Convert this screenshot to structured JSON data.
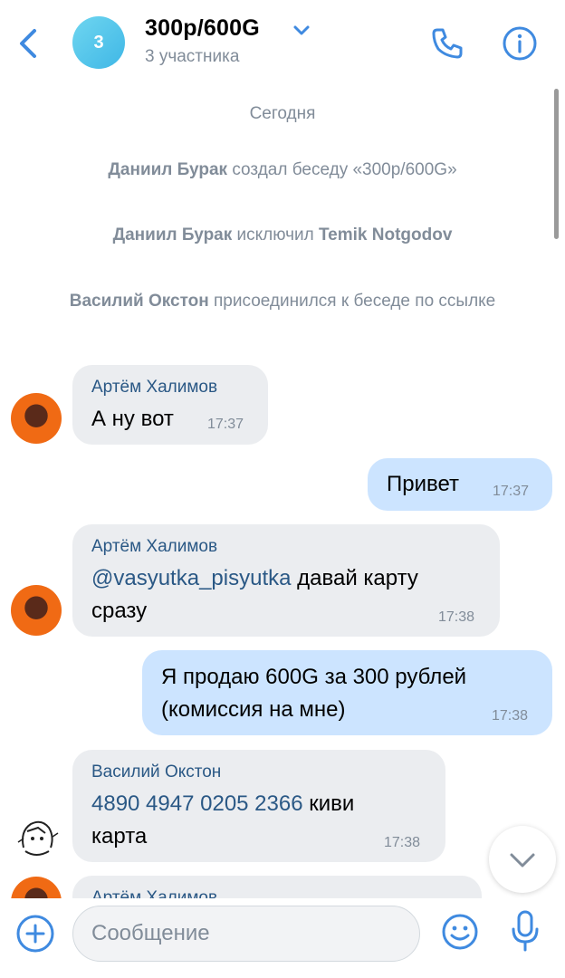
{
  "colors": {
    "accent": "#2a5885",
    "icon": "#3f8ae0",
    "bubble_in": "#ebedf0",
    "bubble_out": "#cce4ff",
    "muted": "#818c99"
  },
  "header": {
    "back_icon": "chevron-left-icon",
    "avatar_text": "3",
    "title": "300р/600G",
    "subtitle": "3 участника",
    "call_icon": "phone-icon",
    "info_icon": "info-icon"
  },
  "service": {
    "date": "Сегодня",
    "e1": {
      "name": "Даниил Бурак",
      "text": " создал беседу «300р/600G»"
    },
    "e2": {
      "name": "Даниил Бурак",
      "text": " исключил ",
      "target": "Temik Notgodov"
    },
    "e3": {
      "name": "Василий Окстон",
      "text": " присоединился к беседе по ссылке"
    }
  },
  "messages": [
    {
      "sender": "Артём Халимов",
      "text": "А ну вот",
      "time": "17:37"
    },
    {
      "text": "Привет",
      "time": "17:37"
    },
    {
      "sender": "Артём Халимов",
      "mention": "@vasyutka_pisyutka",
      "text_line1": " давай карту",
      "text_line2": "сразу",
      "time": "17:38"
    },
    {
      "text_line1": "Я продаю 600G за 300 рублей",
      "text_line2": "(комиссия на мне)",
      "time": "17:38"
    },
    {
      "sender": "Василий Окстон",
      "card": "4890 4947 0205 2366",
      "text_line1": " киви",
      "text_line2": "карта",
      "time": "17:38"
    },
    {
      "sender": "Артём Халимов"
    }
  ],
  "composer": {
    "placeholder": "Сообщение",
    "add_icon": "plus-circle-icon",
    "emoji_icon": "smile-icon",
    "mic_icon": "microphone-icon"
  }
}
